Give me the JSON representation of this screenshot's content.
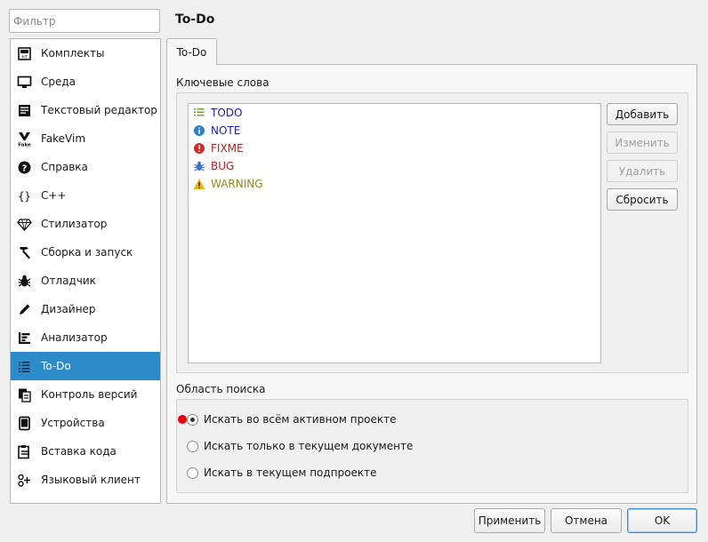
{
  "filter": {
    "placeholder": "Фильтр"
  },
  "sidebar": {
    "items": [
      {
        "label": "Комплекты",
        "icon": "kits-icon"
      },
      {
        "label": "Среда",
        "icon": "monitor-icon"
      },
      {
        "label": "Текстовый редактор",
        "icon": "text-editor-icon"
      },
      {
        "label": "FakeVim",
        "icon": "fakevim-icon"
      },
      {
        "label": "Справка",
        "icon": "help-icon"
      },
      {
        "label": "C++",
        "icon": "braces-icon"
      },
      {
        "label": "Стилизатор",
        "icon": "diamond-icon"
      },
      {
        "label": "Сборка и запуск",
        "icon": "hammer-icon"
      },
      {
        "label": "Отладчик",
        "icon": "bug-icon"
      },
      {
        "label": "Дизайнер",
        "icon": "pencil-icon"
      },
      {
        "label": "Анализатор",
        "icon": "analyzer-icon"
      },
      {
        "label": "To-Do",
        "icon": "todo-list-icon"
      },
      {
        "label": "Контроль версий",
        "icon": "version-control-icon"
      },
      {
        "label": "Устройства",
        "icon": "devices-icon"
      },
      {
        "label": "Вставка кода",
        "icon": "code-paste-icon"
      },
      {
        "label": "Языковый клиент",
        "icon": "language-client-icon"
      }
    ],
    "active_index": 11
  },
  "page": {
    "title": "To-Do",
    "tab": "To-Do"
  },
  "keywords": {
    "title": "Ключевые слова",
    "items": [
      {
        "text": "TODO",
        "color": "#1f1faa",
        "icon": "list-icon"
      },
      {
        "text": "NOTE",
        "color": "#1f1faa",
        "icon": "info-icon"
      },
      {
        "text": "FIXME",
        "color": "#b22222",
        "icon": "error-icon"
      },
      {
        "text": "BUG",
        "color": "#b22222",
        "icon": "bug-icon"
      },
      {
        "text": "WARNING",
        "color": "#8b8b1f",
        "icon": "warning-icon"
      }
    ],
    "buttons": {
      "add": "Добавить",
      "edit": "Изменить",
      "remove": "Удалить",
      "reset": "Сбросить"
    }
  },
  "scope": {
    "title": "Область поиска",
    "options": [
      "Искать во всём активном проекте",
      "Искать только в текущем документе",
      "Искать в текущем подпроекте"
    ],
    "selected_index": 0
  },
  "footer": {
    "apply": "Применить",
    "cancel": "Отмена",
    "ok": "OK"
  },
  "colors": {
    "accent": "#2e8bca"
  }
}
